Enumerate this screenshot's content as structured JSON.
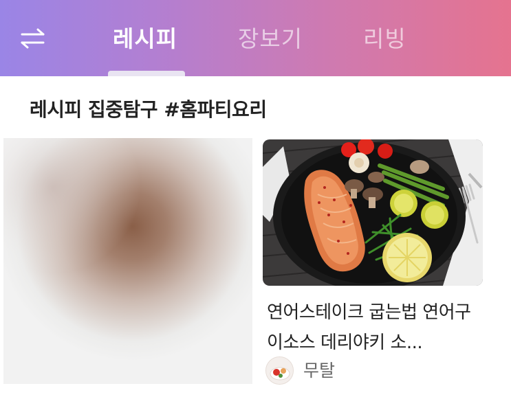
{
  "header": {
    "swap_icon": "swap-arrows-icon",
    "tabs": [
      {
        "label": "레시피",
        "active": true
      },
      {
        "label": "장보기",
        "active": false
      },
      {
        "label": "리빙",
        "active": false
      }
    ],
    "gradient_colors": [
      "#9a85e6",
      "#e5738f"
    ]
  },
  "section": {
    "title": "레시피 집중탐구 #홈파티요리"
  },
  "cards": [
    {
      "image": "blurred-food-photo"
    },
    {
      "image": "salmon-steak-plate-photo",
      "title": "연어스테이크 굽는법 연어구이소스 데리야키 소...",
      "author": "무탈",
      "author_avatar": "food-avatar-icon"
    }
  ]
}
